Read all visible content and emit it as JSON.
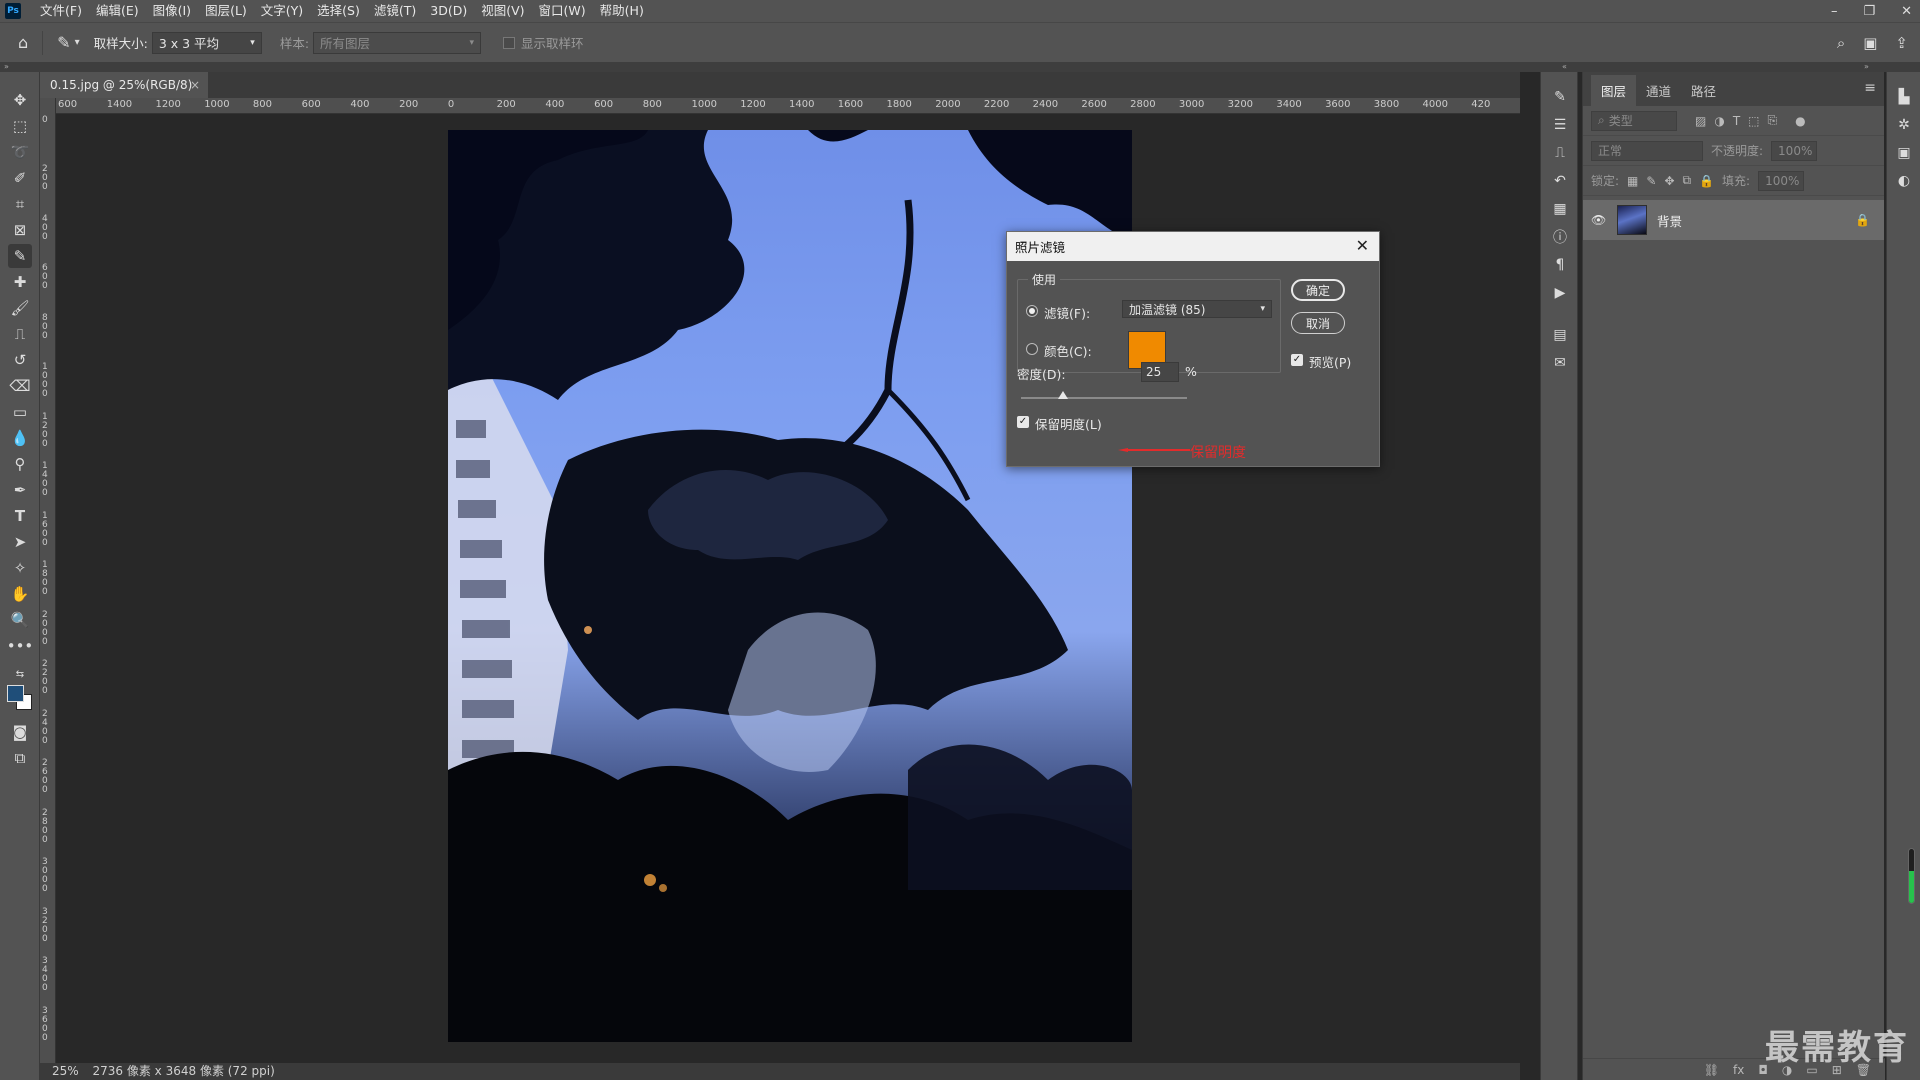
{
  "menubar": {
    "logo": "Ps",
    "items": [
      "文件(F)",
      "编辑(E)",
      "图像(I)",
      "图层(L)",
      "文字(Y)",
      "选择(S)",
      "滤镜(T)",
      "3D(D)",
      "视图(V)",
      "窗口(W)",
      "帮助(H)"
    ]
  },
  "options": {
    "sample_size_label": "取样大小:",
    "sample_size_value": "3 x 3 平均",
    "sample_label": "样本:",
    "sample_value": "所有图层",
    "show_ring_label": "显示取样环"
  },
  "document": {
    "tab_title": "0.15.jpg @ 25%(RGB/8)",
    "close": "×"
  },
  "ruler": {
    "h_labels": [
      "600",
      "1400",
      "1200",
      "1000",
      "800",
      "600",
      "400",
      "200",
      "0",
      "200",
      "400",
      "600",
      "800",
      "1000",
      "1200",
      "1400",
      "1600",
      "1800",
      "2000",
      "2200",
      "2400",
      "2600",
      "2800",
      "3000",
      "3200",
      "3400",
      "3600",
      "3800",
      "4000",
      "420"
    ],
    "v_labels": [
      "0",
      "2 0 0",
      "4 0 0",
      "6 0 0",
      "8 0 0",
      "1 0 0 0",
      "1 2 0 0",
      "1 4 0 0",
      "1 6 0 0",
      "1 8 0 0",
      "2 0 0 0",
      "2 2 0 0",
      "2 4 0 0",
      "2 6 0 0",
      "2 8 0 0",
      "3 0 0 0",
      "3 2 0 0",
      "3 4 0 0",
      "3 6 0 0"
    ]
  },
  "status": {
    "zoom": "25%",
    "info": "2736 像素 x 3648 像素 (72 ppi)"
  },
  "layers_panel": {
    "tabs": [
      "图层",
      "通道",
      "路径"
    ],
    "active_tab": "图层",
    "filter_placeholder": "类型",
    "blend_mode": "正常",
    "opacity_label": "不透明度:",
    "opacity_value": "100%",
    "lock_label": "锁定:",
    "fill_label": "填充:",
    "fill_value": "100%",
    "layers": [
      {
        "name": "背景",
        "visible": true,
        "locked": true
      }
    ],
    "footer_icons": [
      "link-icon",
      "fx-icon",
      "mask-icon",
      "adjustment-icon",
      "folder-icon",
      "new-layer-icon",
      "trash-icon"
    ],
    "footer_glyphs": [
      "⛓",
      "fx",
      "◘",
      "◑",
      "▭",
      "⊞",
      "🗑"
    ]
  },
  "dialog": {
    "title": "照片滤镜",
    "close": "✕",
    "use_label": "使用",
    "filter_label": "滤镜(F):",
    "filter_value": "加温滤镜 (85)",
    "color_label": "颜色(C):",
    "color_hex": "#f08a00",
    "ok_label": "确定",
    "cancel_label": "取消",
    "preview_label": "预览(P)",
    "preview_checked": true,
    "density_label": "密度(D):",
    "density_value": "25",
    "density_unit": "%",
    "density_fraction": 0.25,
    "preserve_label": "保留明度(L)",
    "preserve_checked": true
  },
  "annotation": {
    "text": "保留明度",
    "color": "#e32b2b"
  },
  "watermark": "最需教育",
  "colors": {
    "foreground": "#1f4e79",
    "background": "#ffffff",
    "meter": "#27c24c"
  }
}
